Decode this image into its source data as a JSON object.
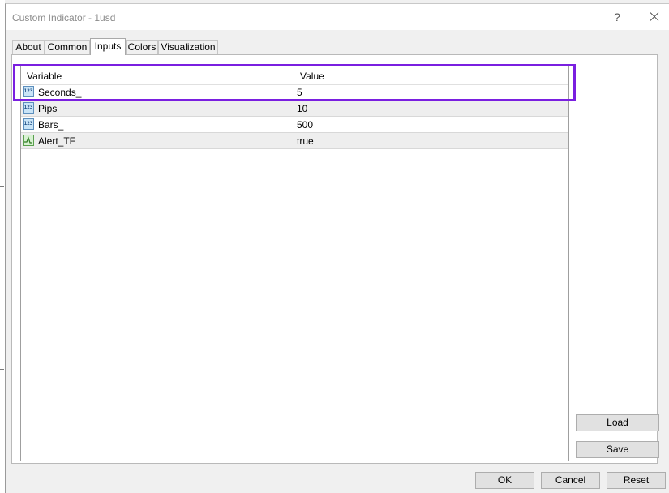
{
  "window": {
    "title": "Custom Indicator - 1usd",
    "help_glyph": "?"
  },
  "tabs": [
    {
      "label": "About",
      "active": false
    },
    {
      "label": "Common",
      "active": false
    },
    {
      "label": "Inputs",
      "active": true
    },
    {
      "label": "Colors",
      "active": false
    },
    {
      "label": "Visualization",
      "active": false
    }
  ],
  "grid": {
    "columns": {
      "variable": "Variable",
      "value": "Value"
    },
    "rows": [
      {
        "variable": "Seconds_",
        "value": "5",
        "type_icon": "number-icon",
        "icon_text": "123"
      },
      {
        "variable": "Pips",
        "value": "10",
        "type_icon": "number-icon",
        "icon_text": "123"
      },
      {
        "variable": "Bars_",
        "value": "500",
        "type_icon": "number-icon",
        "icon_text": "123"
      },
      {
        "variable": "Alert_TF",
        "value": "true",
        "type_icon": "boolean-icon"
      }
    ]
  },
  "side_buttons": {
    "load": "Load",
    "save": "Save"
  },
  "footer_buttons": {
    "ok": "OK",
    "cancel": "Cancel",
    "reset": "Reset"
  },
  "colors": {
    "highlight": "#7a1fe0",
    "number_icon": "#c9e4f7",
    "boolean_icon": "#d8f1d2"
  }
}
